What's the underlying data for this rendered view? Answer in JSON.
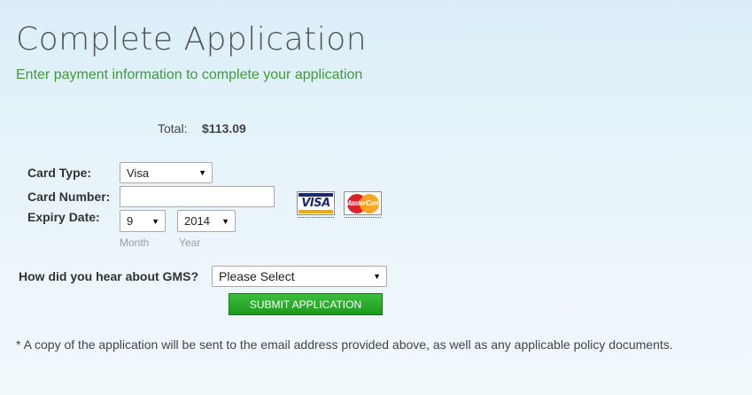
{
  "header": {
    "title": "Complete Application",
    "subtitle": "Enter payment information to complete your application"
  },
  "summary": {
    "total_label": "Total:",
    "total_value": "$113.09"
  },
  "payment": {
    "card_type_label": "Card Type:",
    "card_type_value": "Visa",
    "card_number_label": "Card Number:",
    "card_number_value": "",
    "expiry_label": "Expiry Date:",
    "expiry_month_value": "9",
    "expiry_year_value": "2014",
    "month_hint": "Month",
    "year_hint": "Year",
    "card_logos": [
      "visa-logo",
      "mastercard-logo"
    ],
    "visa_text": "VISA",
    "mastercard_text": "MasterCard"
  },
  "referral": {
    "label": "How did you hear about GMS?",
    "value": "Please Select"
  },
  "actions": {
    "submit_label": "SUBMIT APPLICATION"
  },
  "footer": {
    "note": "* A copy of the application will be sent to the email address provided above, as well as any applicable policy documents."
  },
  "colors": {
    "subtitle_green": "#3e9a3a",
    "button_green": "#2aa52a",
    "title_gray": "#545454"
  }
}
